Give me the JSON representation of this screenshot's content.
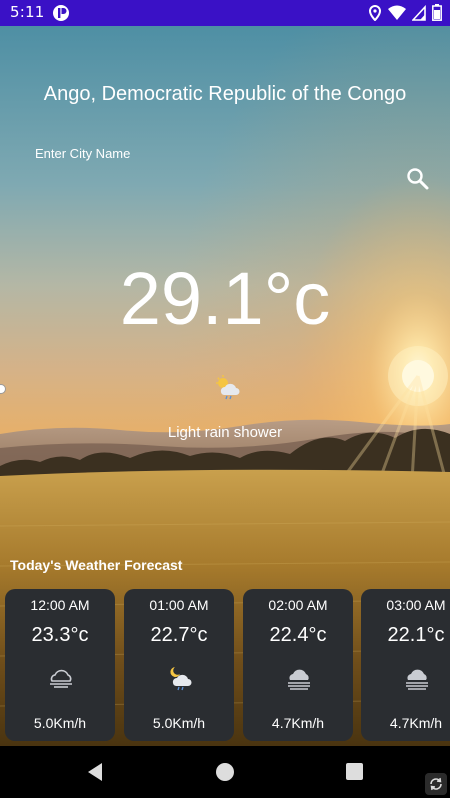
{
  "status_bar": {
    "time": "5:11",
    "icons": [
      "app-notification-icon",
      "location-icon",
      "wifi-icon",
      "signal-icon",
      "battery-icon"
    ],
    "background": "#3a11c6"
  },
  "location": "Ango, Democratic Republic of the Congo",
  "search": {
    "placeholder": "Enter City Name",
    "icon": "search-icon"
  },
  "current": {
    "temperature": "29.1°c",
    "condition": "Light rain shower",
    "icon": "partly-cloudy-rain-icon"
  },
  "forecast": {
    "title": "Today's Weather Forecast",
    "card_color": "#2a2d31",
    "items": [
      {
        "time": "12:00 AM",
        "temp": "23.3°c",
        "icon": "cloud-icon",
        "wind": "5.0Km/h"
      },
      {
        "time": "01:00 AM",
        "temp": "22.7°c",
        "icon": "moon-cloud-rain-icon",
        "wind": "5.0Km/h"
      },
      {
        "time": "02:00 AM",
        "temp": "22.4°c",
        "icon": "fog-cloud-icon",
        "wind": "4.7Km/h"
      },
      {
        "time": "03:00 AM",
        "temp": "22.1°c",
        "icon": "fog-cloud-icon",
        "wind": "4.7Km/h"
      }
    ]
  },
  "nav_bar": {
    "buttons": [
      "back-icon",
      "home-icon",
      "recents-icon",
      "rotate-icon"
    ]
  }
}
